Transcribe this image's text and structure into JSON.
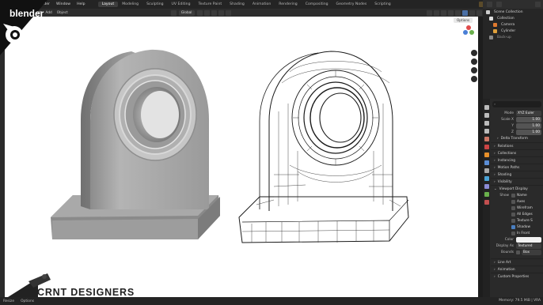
{
  "brand": {
    "app_name": "blender",
    "watermark": "CRNT DESIGNERS"
  },
  "menu": [
    "File",
    "Edit",
    "Render",
    "Window",
    "Help"
  ],
  "workspaces": [
    "Layout",
    "Modeling",
    "Sculpting",
    "UV Editing",
    "Texture Paint",
    "Shading",
    "Animation",
    "Rendering",
    "Compositing",
    "Geometry Nodes",
    "Scripting"
  ],
  "active_workspace": "Layout",
  "scene": {
    "name": "Scene"
  },
  "toolbar": {
    "mode": "Object Mode",
    "items": [
      "View",
      "Select",
      "Add",
      "Object"
    ],
    "orientation": "Global"
  },
  "viewport": {
    "options_label": "Options"
  },
  "outliner": {
    "rows": [
      {
        "label": "Scene Collection",
        "icon": "collection-icon"
      },
      {
        "label": "Collection",
        "icon": "collection-icon"
      },
      {
        "label": "Camera",
        "icon": "camera-icon"
      },
      {
        "label": "Cylinder",
        "icon": "mesh-icon"
      },
      {
        "label": "Back-up",
        "icon": "collection-icon"
      }
    ]
  },
  "properties": {
    "search_placeholder": "",
    "mode_label": "Mode",
    "mode_value": "XYZ Euler",
    "scale": [
      {
        "label": "Scale X",
        "value": "1.00"
      },
      {
        "label": "Y",
        "value": "1.00"
      },
      {
        "label": "Z",
        "value": "1.00"
      }
    ],
    "sections": [
      "Delta Transform",
      "Relations",
      "Collections",
      "Instancing",
      "Motion Paths",
      "Shading",
      "Visibility"
    ],
    "viewport_display": {
      "title": "Viewport Display",
      "show_label": "Show",
      "checks": [
        {
          "label": "Name",
          "on": false
        },
        {
          "label": "Axes",
          "on": false
        },
        {
          "label": "Wirefram",
          "on": false
        },
        {
          "label": "All Edges",
          "on": false
        },
        {
          "label": "Texture S",
          "on": false
        },
        {
          "label": "Shadow",
          "on": true
        },
        {
          "label": "In Front",
          "on": false
        }
      ],
      "color_label": "Color",
      "display_as_label": "Display As",
      "display_as_value": "Textured",
      "bounds_label": "Bounds",
      "bounds_value": "Box"
    },
    "bottom_sections": [
      "Line Art",
      "Animation",
      "Custom Properties"
    ]
  },
  "status": {
    "left": [
      "Resize",
      "Options"
    ],
    "right": "Memory: 79.5 MiB | VRA"
  }
}
